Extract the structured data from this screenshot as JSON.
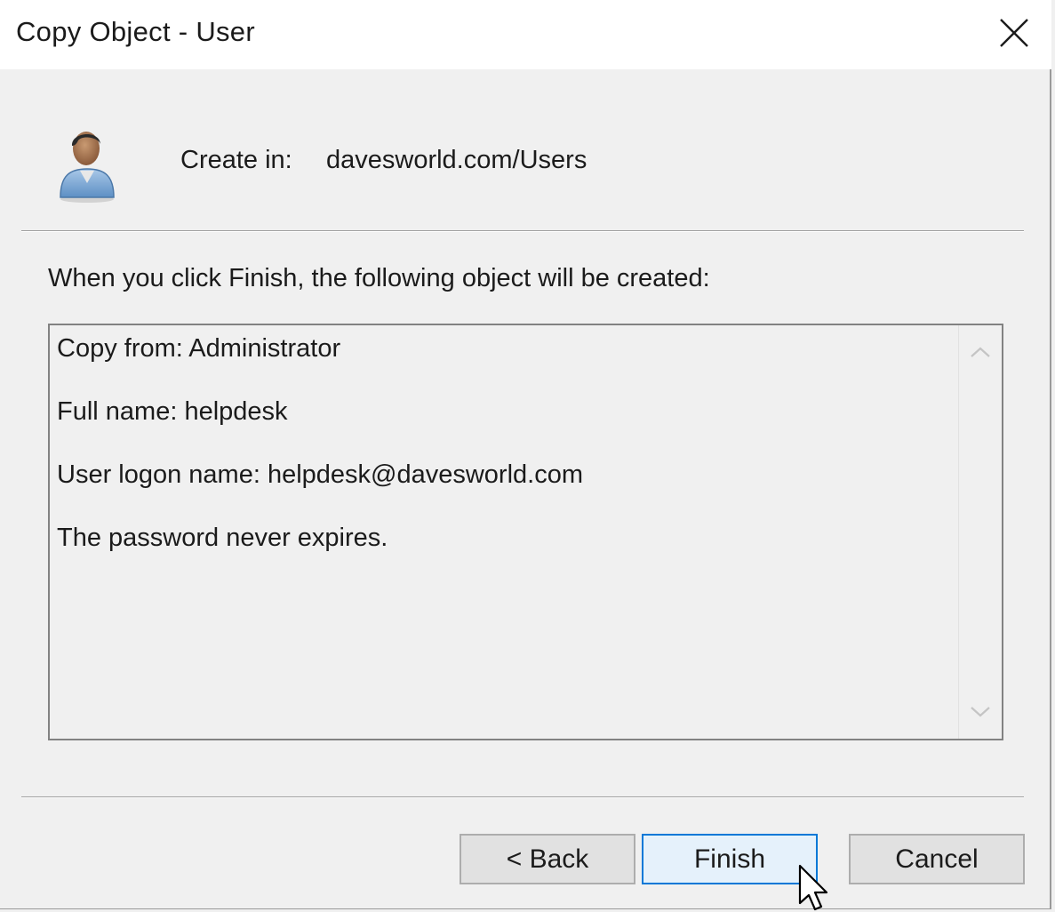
{
  "window": {
    "title": "Copy Object - User"
  },
  "header": {
    "create_in_label": "Create in:",
    "create_in_value": "davesworld.com/Users",
    "icon": "user-icon"
  },
  "body": {
    "instruction": "When you click Finish, the following object will be created:",
    "summary_lines": [
      "Copy from: Administrator",
      "Full name: helpdesk",
      "User logon name: helpdesk@davesworld.com",
      "The password never expires."
    ]
  },
  "buttons": {
    "back": "< Back",
    "finish": "Finish",
    "cancel": "Cancel"
  },
  "colors": {
    "focused_button_border": "#0078d7",
    "focused_button_background": "#e5f1fb"
  }
}
